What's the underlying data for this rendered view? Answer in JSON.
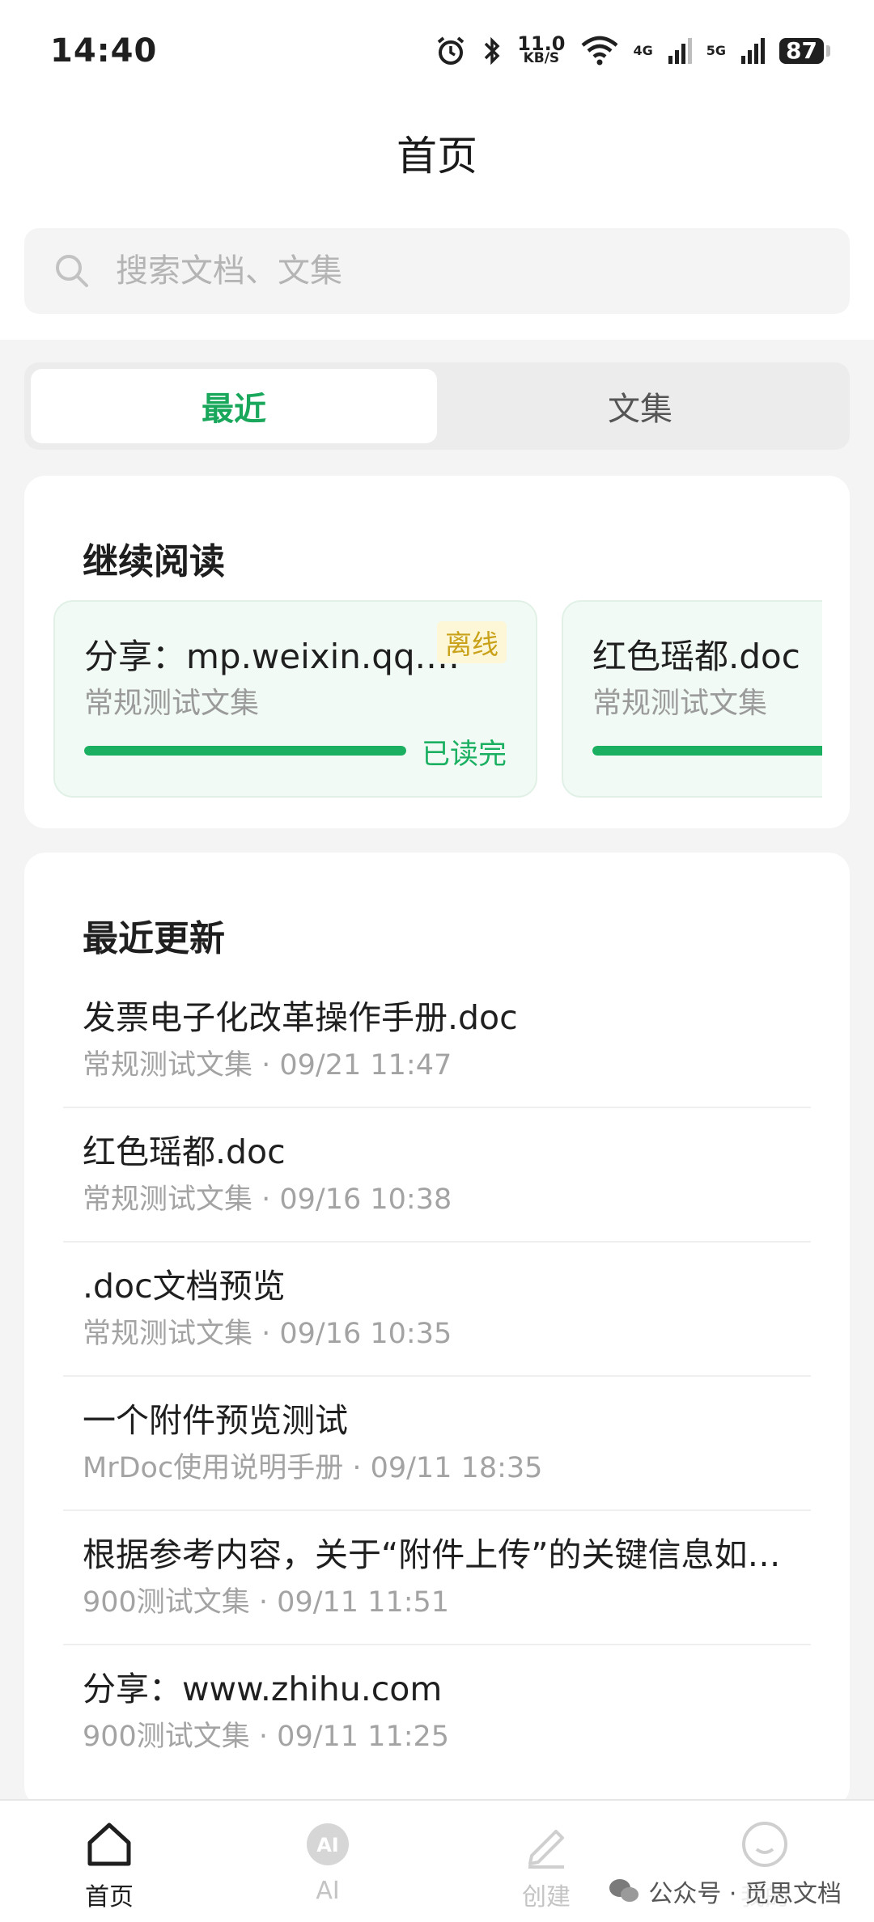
{
  "status_bar": {
    "time": "14:40",
    "net_speed_value": "11.0",
    "net_speed_unit": "KB/S",
    "signal_1_label": "4G",
    "signal_2_label": "5G",
    "battery": "87"
  },
  "header": {
    "title": "首页"
  },
  "search": {
    "placeholder": "搜索文档、文集"
  },
  "tabs": [
    {
      "label": "最近",
      "active": true
    },
    {
      "label": "文集",
      "active": false
    }
  ],
  "continue_reading": {
    "title": "继续阅读",
    "items": [
      {
        "title": "分享：mp.weixin.qq.com",
        "collection": "常规测试文集",
        "badge": "离线",
        "status": "已读完",
        "progress": 1.0
      },
      {
        "title": "红色瑶都.doc",
        "collection": "常规测试文集",
        "badge": "",
        "status": "",
        "progress": 1.0
      }
    ]
  },
  "recent_updates": {
    "title": "最近更新",
    "items": [
      {
        "title": "发票电子化改革操作手册.doc",
        "meta": "常规测试文集 · 09/21 11:47"
      },
      {
        "title": "红色瑶都.doc",
        "meta": "常规测试文集 · 09/16 10:38"
      },
      {
        "title": ".doc文档预览",
        "meta": "常规测试文集 · 09/16 10:35"
      },
      {
        "title": "一个附件预览测试",
        "meta": "MrDoc使用说明手册 · 09/11 18:35"
      },
      {
        "title": "根据参考内容，关于“附件上传”的关键信息如下：",
        "meta": "900测试文集 · 09/11 11:51"
      },
      {
        "title": "分享：www.zhihu.com",
        "meta": "900测试文集 · 09/11 11:25"
      }
    ]
  },
  "bottom_nav": [
    {
      "label": "首页",
      "icon": "home-icon",
      "active": true
    },
    {
      "label": "AI",
      "icon": "ai-icon",
      "active": false
    },
    {
      "label": "创建",
      "icon": "pencil-icon",
      "active": false
    },
    {
      "label": "我的",
      "icon": "smile-icon",
      "active": false
    }
  ],
  "watermark": {
    "text": "公众号 · 觅思文档"
  },
  "colors": {
    "accent": "#19a85b",
    "progress": "#1bb061",
    "badge_bg": "#fdf7d8",
    "badge_text": "#c9a21a"
  }
}
